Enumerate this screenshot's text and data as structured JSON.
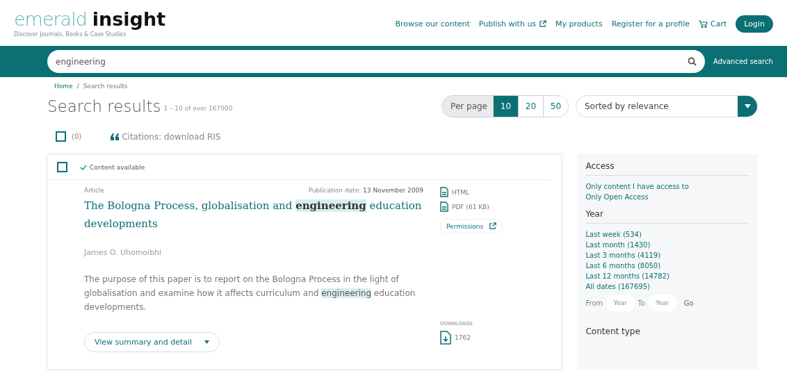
{
  "logo": {
    "word1": "emerald",
    "word2": "insight",
    "tagline": "Discover Journals, Books & Case Studies"
  },
  "nav": [
    {
      "label": "Browse our content",
      "kind": "link"
    },
    {
      "label": "Publish with us",
      "kind": "external"
    },
    {
      "label": "My products",
      "kind": "link"
    },
    {
      "label": "Register for a profile",
      "kind": "link"
    },
    {
      "label": "Cart",
      "kind": "cart"
    }
  ],
  "login": "Login",
  "search": {
    "value": "engineering",
    "advanced": "Advanced search"
  },
  "breadcrumb": {
    "items": [
      "Home",
      "Search results"
    ],
    "separator": "/"
  },
  "heading": {
    "title": "Search results",
    "count": "1 – 10 of over 167000"
  },
  "per_page": {
    "label": "Per page",
    "options": [
      {
        "label": "10",
        "selected": true
      },
      {
        "label": "20",
        "selected": false
      },
      {
        "label": "50",
        "selected": false
      }
    ]
  },
  "sort": "Sorted by relevance",
  "selection": {
    "checked": false,
    "count": "(0)",
    "citations": "Citations: download RIS"
  },
  "result": {
    "checked": false,
    "availability": "Content available",
    "type": "Article",
    "date_label": "Publication date:",
    "date": "13 November 2009",
    "title": "The Bologna Process, globalisation and **engineering** education developments",
    "author": "James O. Uhomoibhi",
    "abstract": "The purpose of this paper is to report on the Bologna Process in the light of globalisation and examine how it affects curriculum and *engineering* education developments.",
    "details": "View summary and detail",
    "formats": [
      {
        "label": "HTML"
      },
      {
        "label": "PDF (61 KB)"
      }
    ],
    "permissions": "Permissions",
    "downloads_label": "DOWNLOADS",
    "downloads": "1762"
  },
  "filters": {
    "access_title": "Access",
    "access": [
      "Only content I have access to",
      "Only Open Access"
    ],
    "year_title": "Year",
    "years": [
      "Last week (534)",
      "Last month (1430)",
      "Last 3 months (4119)",
      "Last 6 months (8050)",
      "Last 12 months (14782)",
      "All dates (167695)"
    ],
    "from": "From",
    "to": "To",
    "from_placeholder": "Year",
    "to_placeholder": "Year",
    "go": "Go",
    "content_title": "Content type"
  }
}
